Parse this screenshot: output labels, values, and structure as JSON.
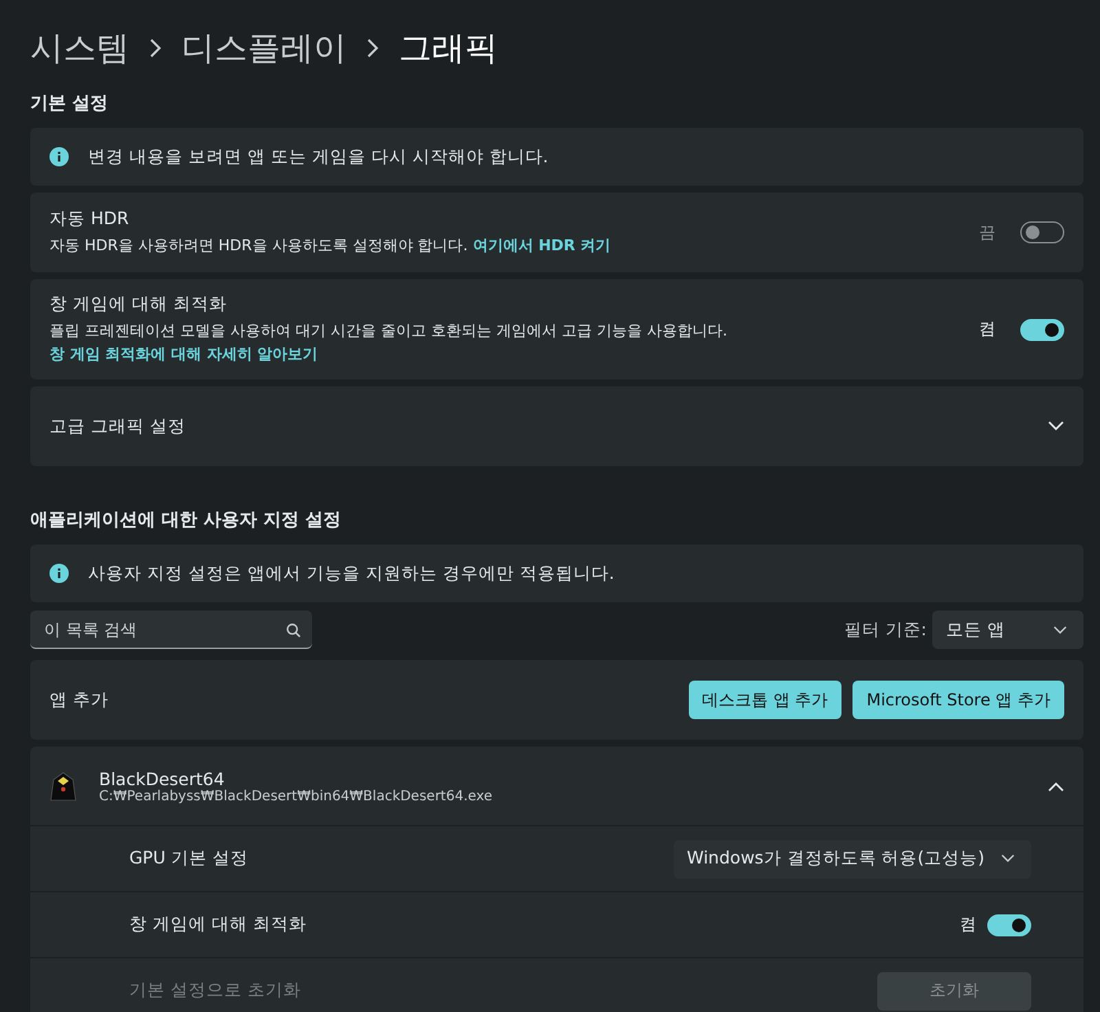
{
  "breadcrumb": [
    "시스템",
    "디스플레이",
    "그래픽"
  ],
  "basic_settings": {
    "heading": "기본 설정",
    "notice": "변경 내용을 보려면 앱 또는 게임을 다시 시작해야 합니다.",
    "rows": [
      {
        "kind": "toggle",
        "title": "자동 HDR",
        "description": "자동 HDR을 사용하려면 HDR을 사용하도록 설정해야 합니다.",
        "link": "여기에서 HDR 켜기",
        "state_label": "끔",
        "on": false
      },
      {
        "kind": "toggle",
        "title": "창 게임에 대해 최적화",
        "description": "플립 프레젠테이션 모델을 사용하여 대기 시간을 줄이고 호환되는 게임에서 고급 기능을 사용합니다.",
        "link": "창 게임 최적화에 대해 자세히 알아보기",
        "state_label": "켬",
        "on": true
      },
      {
        "kind": "expander",
        "title": "고급 그래픽 설정",
        "expanded": false
      }
    ]
  },
  "custom": {
    "heading": "애플리케이션에 대한 사용자 지정 설정",
    "notice": "사용자 지정 설정은 앱에서 기능을 지원하는 경우에만 적용됩니다.",
    "search": {
      "placeholder": "이 목록 검색"
    },
    "filter": {
      "label": "필터 기준:",
      "value": "모든 앱"
    },
    "add_app": {
      "label": "앱 추가",
      "buttons": [
        "데스크톱 앱 추가",
        "Microsoft Store 앱 추가"
      ]
    },
    "apps": [
      {
        "name": "BlackDesert64",
        "path": "C:₩Pearlabyss₩BlackDesert₩bin64₩BlackDesert64.exe",
        "expanded": true,
        "settings": [
          {
            "kind": "dropdown",
            "label": "GPU 기본 설정",
            "value": "Windows가 결정하도록 허용(고성능)"
          },
          {
            "kind": "toggle",
            "label": "창 게임에 대해 최적화",
            "state_label": "켬",
            "on": true
          },
          {
            "kind": "reset",
            "label": "기본 설정으로 초기화",
            "button": "초기화",
            "disabled": true
          }
        ]
      }
    ]
  }
}
